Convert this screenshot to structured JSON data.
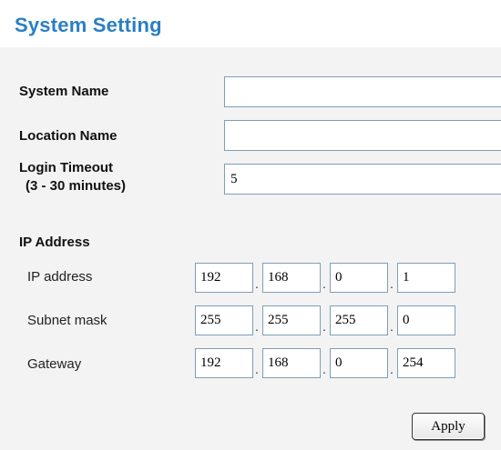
{
  "page": {
    "title": "System Setting"
  },
  "system_name": {
    "label": "System Name",
    "value": ""
  },
  "location_name": {
    "label": "Location Name",
    "value": ""
  },
  "login_timeout": {
    "label": "Login Timeout",
    "hint": "(3 - 30 minutes)",
    "value": "5"
  },
  "ip_section": {
    "heading": "IP Address",
    "rows": [
      {
        "label": "IP address",
        "octets": [
          "192",
          "168",
          "0",
          "1"
        ]
      },
      {
        "label": "Subnet mask",
        "octets": [
          "255",
          "255",
          "255",
          "0"
        ]
      },
      {
        "label": "Gateway",
        "octets": [
          "192",
          "168",
          "0",
          "254"
        ]
      }
    ],
    "separator": "."
  },
  "actions": {
    "apply_label": "Apply"
  },
  "colors": {
    "title": "#2a7fc4",
    "panel_bg": "#f3f3f3",
    "input_border": "#7f9db9"
  }
}
